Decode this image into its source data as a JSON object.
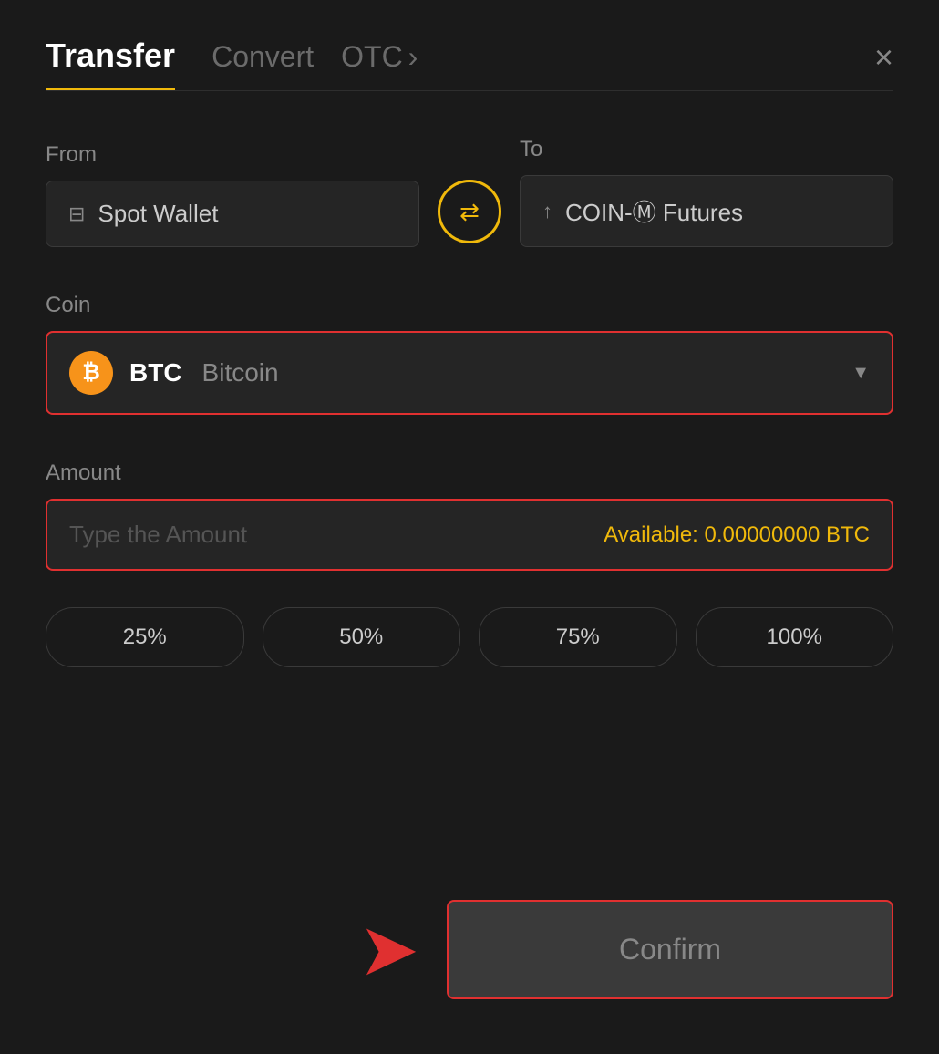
{
  "header": {
    "tab_transfer": "Transfer",
    "tab_convert": "Convert",
    "tab_otc": "OTC",
    "tab_otc_chevron": "›",
    "close_label": "×"
  },
  "from_section": {
    "label": "From",
    "wallet_label": "Spot Wallet"
  },
  "swap": {
    "icon": "⇄"
  },
  "to_section": {
    "label": "To",
    "wallet_label": "COIN-Ⓜ Futures"
  },
  "coin_section": {
    "label": "Coin",
    "coin_ticker": "BTC",
    "coin_name": "Bitcoin"
  },
  "amount_section": {
    "label": "Amount",
    "placeholder": "Type the Amount",
    "available_label": "Available:",
    "available_value": "0.00000000 BTC"
  },
  "percent_buttons": [
    "25%",
    "50%",
    "75%",
    "100%"
  ],
  "confirm_button": {
    "label": "Confirm"
  }
}
